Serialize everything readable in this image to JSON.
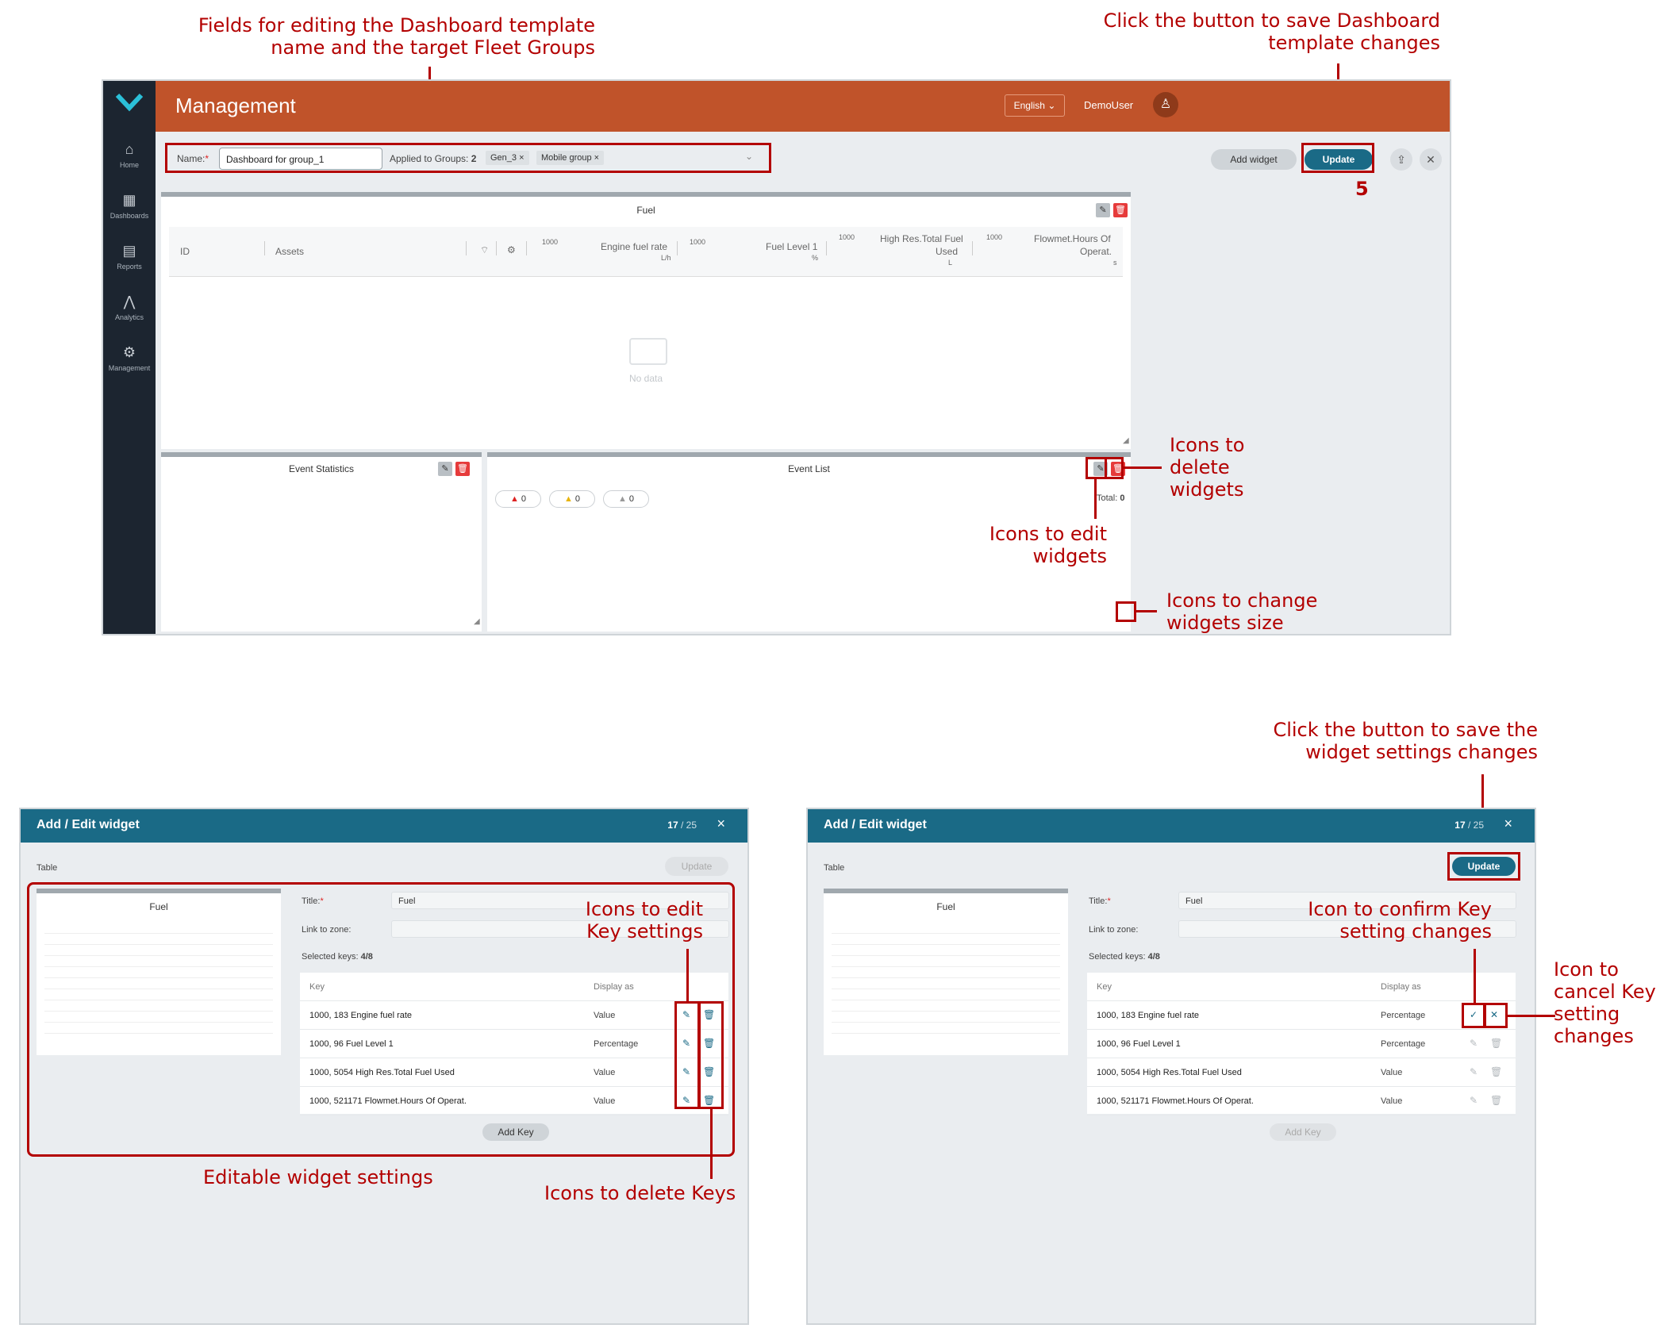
{
  "annotations": {
    "fields_editing": [
      "Fields for editing the Dashboard template",
      "name and the target Fleet Groups"
    ],
    "save_dashboard": [
      "Click the button to save Dashboard",
      "template changes"
    ],
    "step_number": "5",
    "icons_delete_widgets": [
      "Icons to",
      "delete",
      "widgets"
    ],
    "icons_edit_widgets": [
      "Icons to edit",
      "widgets"
    ],
    "icons_change_size": [
      "Icons to change",
      "widgets size"
    ],
    "save_widget": [
      "Click the button to save the",
      "widget settings changes"
    ],
    "icons_edit_keys": [
      "Icons to edit",
      "Key settings"
    ],
    "editable_settings": "Editable widget settings",
    "icons_delete_keys": "Icons to delete Keys",
    "icon_confirm": [
      "Icon to confirm Key",
      "setting changes"
    ],
    "icon_cancel": [
      "Icon to",
      "cancel Key",
      "setting",
      "changes"
    ]
  },
  "sidebar": {
    "items": [
      {
        "label": "Home",
        "icon": "home-icon"
      },
      {
        "label": "Dashboards",
        "icon": "dashboards-icon"
      },
      {
        "label": "Reports",
        "icon": "reports-icon"
      },
      {
        "label": "Analytics",
        "icon": "analytics-icon"
      },
      {
        "label": "Management",
        "icon": "gear-icon"
      }
    ]
  },
  "topbar": {
    "title": "Management",
    "language": "English",
    "user": "DemoUser"
  },
  "toolbar": {
    "name_label": "Name:",
    "name_required": "*",
    "name_value": "Dashboard for group_1",
    "groups_label": "Applied to Groups:",
    "groups_count": "2",
    "tags": [
      "Gen_3",
      "Mobile group"
    ],
    "add_widget": "Add widget",
    "update": "Update"
  },
  "fuel_widget": {
    "title": "Fuel",
    "columns": {
      "id": "ID",
      "assets": "Assets",
      "c1_num": "1000",
      "c1_name": "Engine fuel rate",
      "c1_unit": "L/h",
      "c2_num": "1000",
      "c2_name": "Fuel Level 1",
      "c2_unit": "%",
      "c3_num": "1000",
      "c3_name": "High Res.Total Fuel",
      "c3_name2": "Used",
      "c3_unit": "L",
      "c4_num": "1000",
      "c4_name": "Flowmet.Hours Of",
      "c4_name2": "Operat.",
      "c4_unit": "s"
    },
    "empty": "No data"
  },
  "event_stats": {
    "title": "Event Statistics"
  },
  "event_list": {
    "title": "Event List",
    "counts": [
      "0",
      "0",
      "0"
    ],
    "total_label": "Total:",
    "total_value": "0"
  },
  "dialog_left": {
    "title": "Add / Edit widget",
    "count_current": "17",
    "count_total": "/ 25",
    "type": "Table",
    "update": "Update",
    "preview_title": "Fuel",
    "title_label": "Title:",
    "title_value": "Fuel",
    "zone_label": "Link to zone:",
    "selected_label": "Selected keys:",
    "selected_value": "4/8",
    "col_key": "Key",
    "col_display": "Display as",
    "rows": [
      {
        "key": "1000, 183 Engine fuel rate",
        "display": "Value"
      },
      {
        "key": "1000, 96 Fuel Level 1",
        "display": "Percentage"
      },
      {
        "key": "1000, 5054 High Res.Total Fuel Used",
        "display": "Value"
      },
      {
        "key": "1000, 521171 Flowmet.Hours Of Operat.",
        "display": "Value"
      }
    ],
    "add_key": "Add Key"
  },
  "dialog_right": {
    "title": "Add / Edit widget",
    "count_current": "17",
    "count_total": "/ 25",
    "type": "Table",
    "update": "Update",
    "preview_title": "Fuel",
    "title_label": "Title:",
    "title_value": "Fuel",
    "zone_label": "Link to zone:",
    "selected_label": "Selected keys:",
    "selected_value": "4/8",
    "col_key": "Key",
    "col_display": "Display as",
    "rows": [
      {
        "key": "1000, 183 Engine fuel rate",
        "display": "Percentage"
      },
      {
        "key": "1000, 96 Fuel Level 1",
        "display": "Percentage"
      },
      {
        "key": "1000, 5054 High Res.Total Fuel Used",
        "display": "Value"
      },
      {
        "key": "1000, 521171 Flowmet.Hours Of Operat.",
        "display": "Value"
      }
    ],
    "add_key": "Add Key"
  },
  "colors": {
    "accent": "#c0532a",
    "teal": "#1a6a86",
    "annotation": "#b30000",
    "sidebar": "#1c2530"
  }
}
